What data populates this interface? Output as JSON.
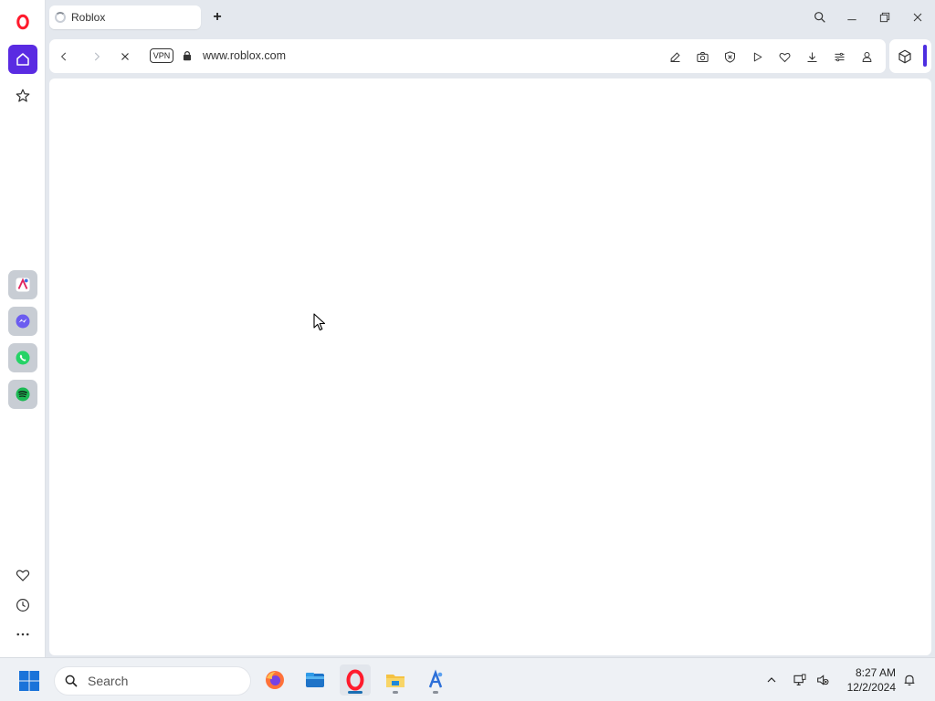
{
  "browser": {
    "tab": {
      "title": "Roblox",
      "newtab_label": "+"
    },
    "address_bar": {
      "vpn_label": "VPN",
      "url": "www.roblox.com"
    }
  },
  "taskbar": {
    "search_placeholder": "Search",
    "clock": {
      "time": "8:27 AM",
      "date": "12/2/2024"
    }
  },
  "colors": {
    "accent": "#5a2be2",
    "opera_red": "#ff1b2d",
    "viewport_bg": "#ffffff"
  }
}
